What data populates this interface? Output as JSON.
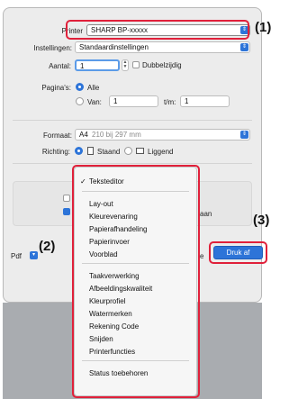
{
  "form": {
    "printer_label": "Printer",
    "printer_value": "SHARP BP-xxxxx",
    "presets_label": "Instellingen:",
    "presets_value": "Standaardinstellingen",
    "copies_label": "Aantal:",
    "copies_value": "1",
    "two_sided_label": "Dubbelzijdig",
    "pages_label": "Pagina's:",
    "pages_all": "Alle",
    "pages_from": "Van:",
    "pages_from_value": "1",
    "pages_to": "t/m:",
    "pages_to_value": "1",
    "format_label": "Formaat:",
    "format_value": "A4",
    "format_detail": "210 bij 297 mm",
    "orientation_label": "Richting:",
    "orientation_portrait": "Staand",
    "orientation_landscape": "Liggend"
  },
  "menu": {
    "items": [
      "Teksteditor",
      "Lay-out",
      "Kleurevenaring",
      "Papierafhandeling",
      "Papierinvoer",
      "Voorblad",
      "Taakverwerking",
      "Afbeeldingskwaliteit",
      "Kleurprofiel",
      "Watermerken",
      "Rekening Code",
      "Snijden",
      "Printerfuncties",
      "Status toebehoren"
    ]
  },
  "background": {
    "partial_text": "aan",
    "pdf_label": "Pdf",
    "partial_e": "e"
  },
  "print_button": "Druk af",
  "callouts": {
    "one": "(1)",
    "two": "(2)",
    "three": "(3)"
  },
  "colors": {
    "accent": "#2d74d8",
    "callout": "#e0203a"
  }
}
